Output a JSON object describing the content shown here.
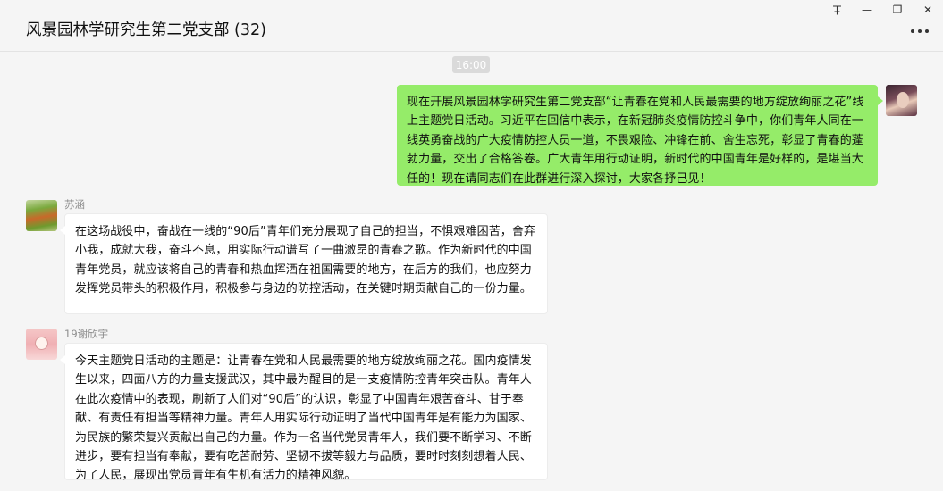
{
  "window": {
    "title": "风景园林学研究生第二党支部 (32)",
    "controls": {
      "pin_icon": "pin-icon",
      "minimize": "—",
      "restore": "❐",
      "close": "✕"
    }
  },
  "chat": {
    "timestamp": "16:00",
    "messages": [
      {
        "from": "me",
        "text": "现在开展风景园林学研究生第二党支部“让青春在党和人民最需要的地方绽放绚丽之花”线上主题党日活动。习近平在回信中表示，在新冠肺炎疫情防控斗争中，你们青年人同在一线英勇奋战的广大疫情防控人员一道，不畏艰险、冲锋在前、舍生忘死，彰显了青春的蓬勃力量，交出了合格答卷。广大青年用行动证明，新时代的中国青年是好样的，是堪当大任的！现在请同志们在此群进行深入探讨，大家各抒己见！"
      },
      {
        "from": "other",
        "sender": "苏涵",
        "text": "在这场战役中，奋战在一线的“90后”青年们充分展现了自己的担当，不惧艰难困苦，舍弃小我，成就大我，奋斗不息，用实际行动谱写了一曲激昂的青春之歌。作为新时代的中国青年党员，就应该将自己的青春和热血挥洒在祖国需要的地方，在后方的我们，也应努力发挥党员带头的积极作用，积极参与身边的防控活动，在关键时期贡献自己的一份力量。"
      },
      {
        "from": "other",
        "sender": "19谢欣宇",
        "text": "今天主题党日活动的主题是：让青春在党和人民最需要的地方绽放绚丽之花。国内疫情发生以来，四面八方的力量支援武汉，其中最为醒目的是一支疫情防控青年突击队。青年人在此次疫情中的表现，刷新了人们对“90后”的认识，彰显了中国青年艰苦奋斗、甘于奉献、有责任有担当等精神力量。青年人用实际行动证明了当代中国青年是有能力为国家、为民族的繁荣复兴贡献出自己的力量。作为一名当代党员青年人，我们要不断学习、不断进步，要有担当有奉献，要有吃苦耐劳、坚韧不拔等毅力与品质，要时时刻刻想着人民、为了人民，展现出党员青年有生机有活力的精神风貌。"
      }
    ]
  },
  "colors": {
    "self_bubble": "#95ec69",
    "other_bubble": "#ffffff",
    "background": "#f5f5f5"
  }
}
